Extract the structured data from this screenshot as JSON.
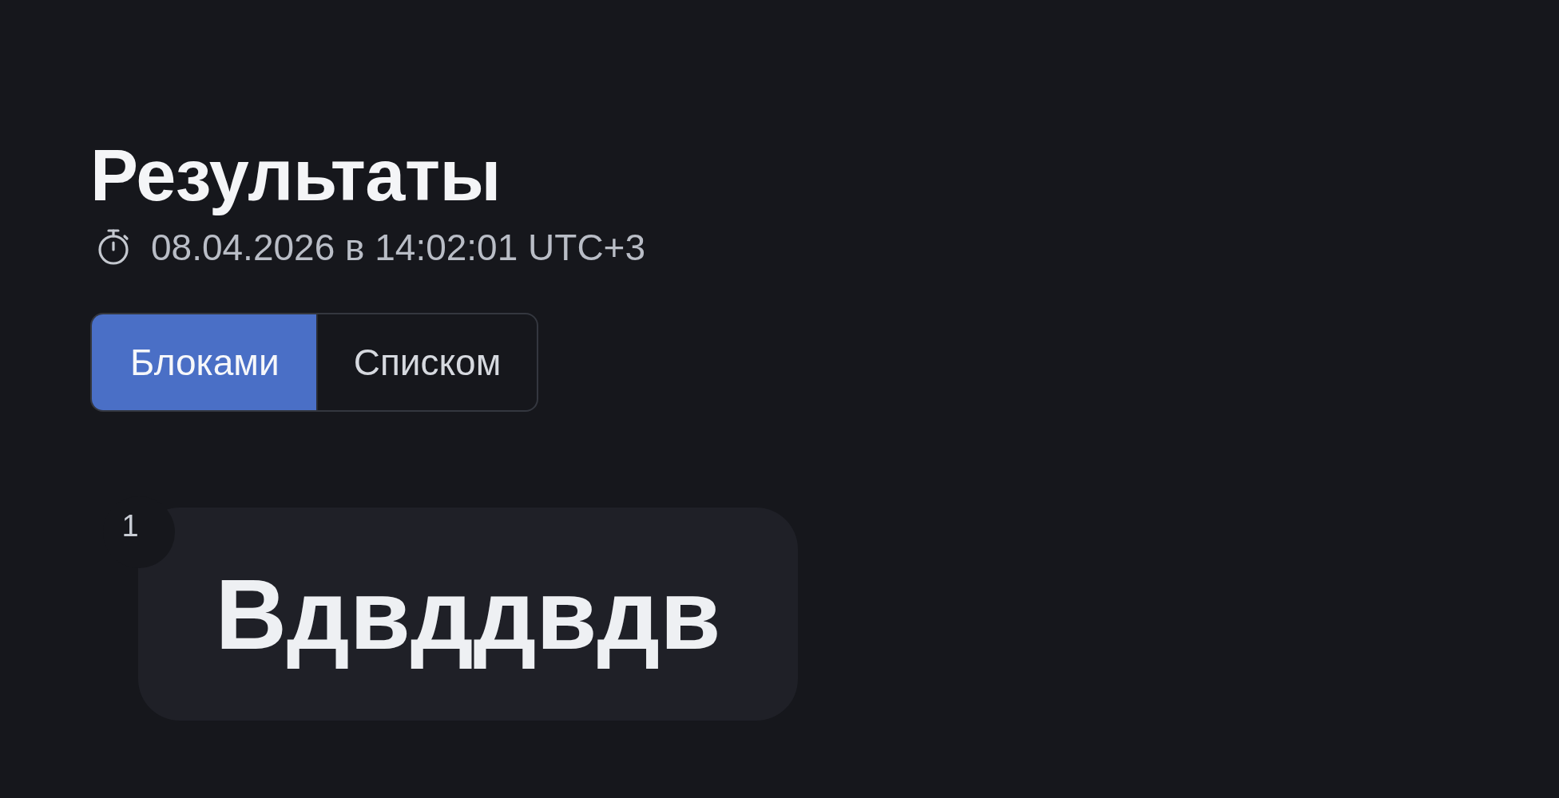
{
  "title": "Результаты",
  "timestamp": "08.04.2026 в 14:02:01 UTC+3",
  "view_tabs": [
    {
      "label": "Блоками",
      "selected": true
    },
    {
      "label": "Списком",
      "selected": false
    }
  ],
  "blocks": [
    {
      "number": "1",
      "text": "Вдвддвдв"
    }
  ]
}
